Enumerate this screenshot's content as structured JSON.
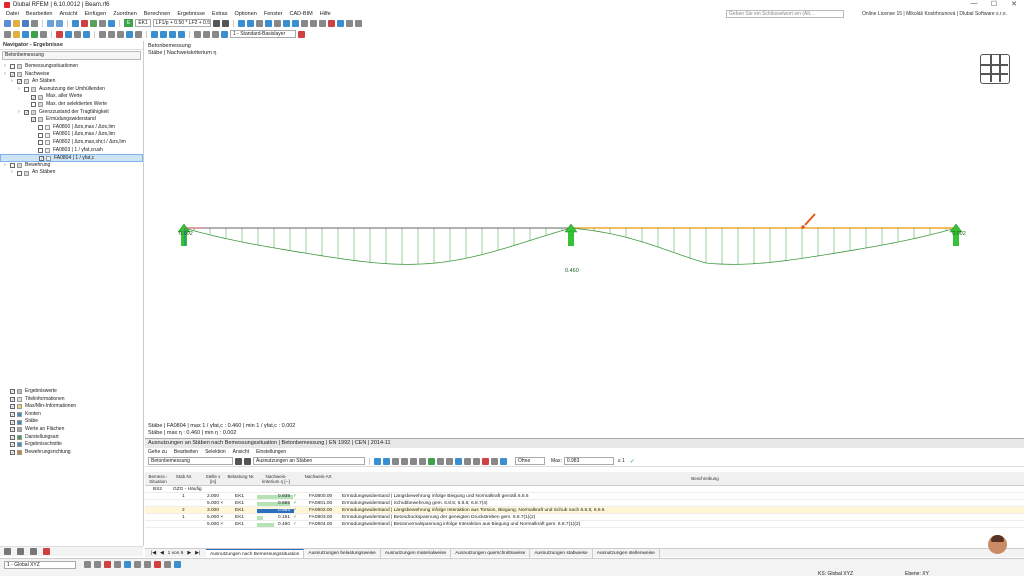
{
  "window": {
    "title": "Dlubal RFEM | 6.10.0012 | Beam.rf6"
  },
  "menu": {
    "items": [
      "Datei",
      "Bearbeiten",
      "Ansicht",
      "Einfügen",
      "Zuordnen",
      "Berechnen",
      "Ergebnisse",
      "Extras",
      "Optionen",
      "Fenster",
      "CAD-BIM",
      "Hilfe"
    ],
    "search_placeholder": "Geben Sie ein Schlüsselwort ein (Alt...",
    "license": "Online License 15 | Mikoláš Kostrhounová | Dlubal Software s.r.o."
  },
  "toolbar": {
    "load_case_tag": "EK1",
    "combo_prefix": "E",
    "load_combination": "LF1/p + 0.50 * LF2 + 0.50 * L...",
    "view_layer": "1 - Standard-Basislayer"
  },
  "navigator": {
    "title": "Navigator - Ergebnisse",
    "selector": "Betonbemessung",
    "tree": [
      {
        "label": "Bemessungssituationen",
        "level": 0,
        "checked": false
      },
      {
        "label": "Nachweise",
        "level": 0,
        "checked": true
      },
      {
        "label": "An Stäben",
        "level": 1,
        "checked": true
      },
      {
        "label": "Ausnutzung der Umhüllenden",
        "level": 2,
        "checked": false
      },
      {
        "label": "Max. aller Werte",
        "level": 3,
        "checked": true
      },
      {
        "label": "Max. der selektierten Werte",
        "level": 3,
        "checked": false
      },
      {
        "label": "Grenzzustand der Tragfähigkeit",
        "level": 2,
        "checked": true
      },
      {
        "label": "Ermüdungswiderstand",
        "level": 3,
        "checked": true
      },
      {
        "label": "FA0800 | Δσs,max / Δσs,lim",
        "level": 4,
        "checked": false
      },
      {
        "label": "FA0801 | Δσs,max / Δσs,lim",
        "level": 4,
        "checked": false
      },
      {
        "label": "FA0802 | Δσs,max,shr,t / Δσs,lim",
        "level": 4,
        "checked": false
      },
      {
        "label": "FA0803 | 1 / γfat,crush",
        "level": 4,
        "checked": false
      },
      {
        "label": "FA0804 | 1 / γfat,c",
        "level": 4,
        "checked": true
      },
      {
        "label": "Bewehrung",
        "level": 0,
        "checked": false
      },
      {
        "label": "An Stäben",
        "level": 1,
        "checked": false
      }
    ],
    "tree_bottom": [
      {
        "label": "Ergebniswerte",
        "checked": true
      },
      {
        "label": "Titelinformationen",
        "checked": true
      },
      {
        "label": "Max/Min-Informationen",
        "checked": true
      },
      {
        "label": "Knoten",
        "checked": true
      },
      {
        "label": "Stäbe",
        "checked": true
      },
      {
        "label": "Werte an Flächen",
        "checked": true
      },
      {
        "label": "Darstellungsart",
        "checked": true
      },
      {
        "label": "Ergebnisschnitte",
        "checked": true
      },
      {
        "label": "Bewehrungsrichtung",
        "checked": true
      }
    ]
  },
  "viewport": {
    "title_line1": "Betonbemessung",
    "title_line2": "Stäbe | Nachweiskriterium η",
    "label_left": "0.002",
    "label_right": "0.002",
    "label_min": "0.460",
    "info_line1": "Stäbe | FA0804 | max 1 / γfat,c : 0.460 | min 1 / γfat,c : 0.002",
    "info_line2": "Stäbe | max η : 0.460 | min η : 0.002",
    "axis_x": "X",
    "axis_z": "Z"
  },
  "panel": {
    "title": "Ausnutzungen an Stäben nach Bemessungssituation | Betonbemessung | EN 1992 | CEN | 2014-11",
    "menu": [
      "Gehe zu",
      "Bearbeiten",
      "Selektion",
      "Ansicht",
      "Einstellungen"
    ],
    "combo1": "Betonbemessung",
    "combo2": "Ausnutzungen an Stäben",
    "filter_label": "Ohne",
    "max_label": "Max:",
    "max_value": "0.983",
    "max_unit": "≤ 1",
    "headers": {
      "situation": "Bemess.-Situation",
      "member": "Stab Nr.",
      "location": "Stelle x [m]",
      "loading": "Belastung Nr.",
      "criterion": "Nachweis-kriterium η [--]",
      "type": "Nachweis-Art",
      "description": "Beschreibung"
    },
    "group_row": {
      "situation": "BS2",
      "label": "GZG - Häufig"
    },
    "rows": [
      {
        "member": "1",
        "location": "2.000",
        "loading": "EK1",
        "value": "0.939",
        "fraction": 0.939,
        "type": "FA0800.00",
        "description": "Ermüdungswiderstand | Längsbewehrung infolge Biegung und Normalkraft gemäß 6.8.6"
      },
      {
        "member": "",
        "location": "5.000 ×",
        "loading": "EK1",
        "value": "0.865",
        "fraction": 0.865,
        "type": "FA0801.00",
        "description": "Ermüdungswiderstand | Schubbewehrung gem. 6.8.5; 6.8.6; 6.8.7(4)"
      },
      {
        "member": "2",
        "location": "3.000",
        "loading": "EK1",
        "value": "0.983",
        "fraction": 0.983,
        "type": "FA0802.00",
        "description": "Ermüdungswiderstand | Längsbewehrung infolge Interaktion aus Torsion, Biegung, Normalkraft und Schub nach 6.8.5; 6.8.6"
      },
      {
        "member": "1",
        "location": "5.000 ×",
        "loading": "EK1",
        "value": "0.151",
        "fraction": 0.151,
        "type": "FA0803.00",
        "description": "Ermüdungswiderstand | Betondruckspannung der geneigten Druckstreben gem. 6.8.7(1)(2)"
      },
      {
        "member": "",
        "location": "5.000 ×",
        "loading": "EK1",
        "value": "0.460",
        "fraction": 0.46,
        "type": "FA0804.00",
        "description": "Ermüdungswiderstand | Betonnormalspannung infolge Interaktion aus Biegung und Normalkraft gem. 6.8.7(1)(2)"
      }
    ]
  },
  "tabs": {
    "page": "1 von 6",
    "items": [
      "Ausnutzungen nach Bemessungssituation",
      "Ausnutzungen belastungsweise",
      "Ausnutzungen materialweise",
      "Ausnutzungen querschnittsweise",
      "Ausnutzungen stabweise",
      "Ausnutzungen stellenweise"
    ]
  },
  "statusbar": {
    "coord_system": "1 - Global XYZ",
    "ks": "KS: Global XYZ",
    "plane": "Ebene: XY"
  },
  "colors": {
    "accent": "#2c6fbd",
    "diagram": "#3f9a3f",
    "beam": "#f0a830",
    "support": "#36c236"
  }
}
